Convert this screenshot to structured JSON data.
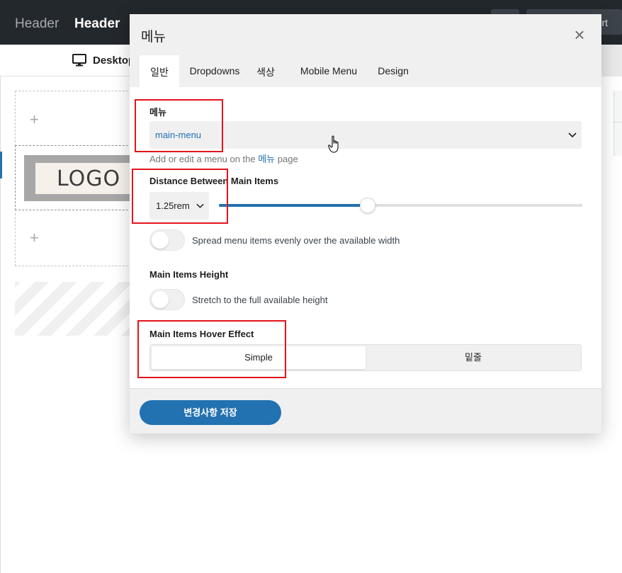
{
  "topbar": {
    "crumb": "Header",
    "title": "Header",
    "right_button_label": "rt"
  },
  "devbar": {
    "device_label": "Desktop",
    "device_icon": "desktop-icon"
  },
  "canvas": {
    "plus": "+",
    "logo_text": "LOGO"
  },
  "modal": {
    "title": "메뉴",
    "close_icon": "close-icon",
    "tabs": [
      {
        "label": "일반"
      },
      {
        "label": "Dropdowns"
      },
      {
        "label": "색상"
      },
      {
        "label": "Mobile Menu"
      },
      {
        "label": "Design"
      }
    ],
    "active_tab": "일반",
    "menu": {
      "label": "메뉴",
      "selected": "main-menu",
      "help_prefix": "Add or edit a menu on the ",
      "help_link": "메뉴",
      "help_suffix": " page"
    },
    "distance": {
      "label": "Distance Between Main Items",
      "unit_value": "1.25rem",
      "slider_fraction": 0.41
    },
    "spread": {
      "label": "Spread menu items evenly over the available width",
      "enabled": false
    },
    "height": {
      "label": "Main Items Height",
      "toggle_label": "Stretch to the full available height",
      "enabled": false
    },
    "hover": {
      "label": "Main Items Hover Effect",
      "options": [
        "Simple",
        "밑줄"
      ],
      "selected": "Simple"
    },
    "save_label": "변경사항 저장"
  },
  "colors": {
    "accent": "#2271b1",
    "highlight": "#e3141c",
    "topbar": "#23282d"
  }
}
